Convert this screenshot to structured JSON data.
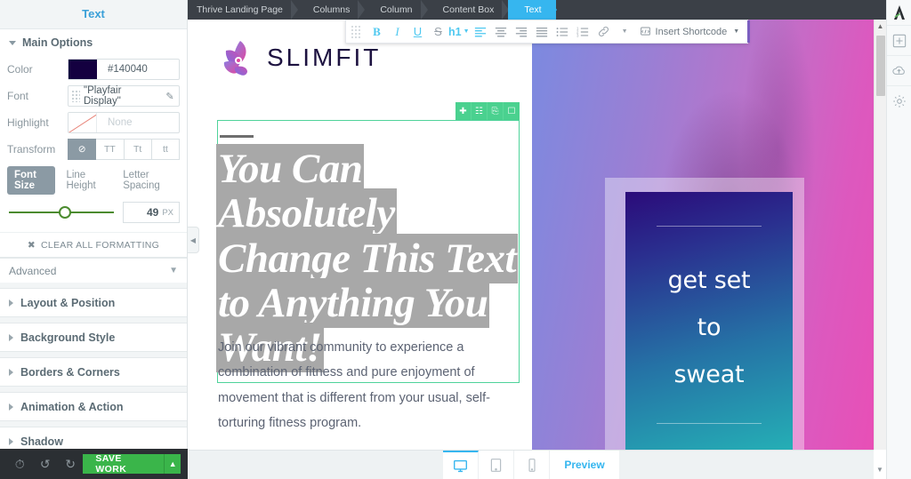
{
  "sidebar": {
    "title": "Text",
    "main_options": {
      "label": "Main Options",
      "color": {
        "label": "Color",
        "value": "#140040",
        "swatch": "#140040"
      },
      "font": {
        "label": "Font",
        "value": "\"Playfair Display\"",
        "edit_icon": "pencil-icon"
      },
      "highlight": {
        "label": "Highlight",
        "value": "None"
      },
      "transform": {
        "label": "Transform",
        "options": [
          "⊘",
          "TT",
          "Tt",
          "tt"
        ],
        "active_index": 0
      },
      "size_tabs": [
        "Font Size",
        "Line Height",
        "Letter Spacing"
      ],
      "size_tab_active": "Font Size",
      "slider_value": "49",
      "slider_unit": "PX",
      "clear_formatting": "CLEAR ALL FORMATTING",
      "advanced": "Advanced"
    },
    "accordions": [
      "Layout & Position",
      "Background Style",
      "Borders & Corners",
      "Animation & Action",
      "Shadow"
    ],
    "footer": {
      "history_icon": "clock-icon",
      "undo_icon": "undo-icon",
      "redo_icon": "redo-icon",
      "save_label": "SAVE WORK",
      "save_color": "#3ab54a"
    },
    "collapse_icon": "chevron-left-icon"
  },
  "breadcrumb": {
    "items": [
      {
        "label": "Thrive Landing Page",
        "active": false
      },
      {
        "label": "Columns",
        "active": false
      },
      {
        "label": "Column",
        "active": false
      },
      {
        "label": "Content Box",
        "active": false
      },
      {
        "label": "Text",
        "active": true
      }
    ],
    "active_color": "#36b6ef"
  },
  "format_toolbar": {
    "grip": "drag-grip-icon",
    "buttons": [
      {
        "name": "bold",
        "label": "B",
        "active": true
      },
      {
        "name": "italic",
        "label": "I",
        "active": true
      },
      {
        "name": "underline",
        "label": "U",
        "active": true
      },
      {
        "name": "strikethrough",
        "label": "S",
        "active": false
      },
      {
        "name": "heading",
        "label": "h1",
        "active": true,
        "dropdown": true
      }
    ],
    "align": [
      {
        "name": "align-left",
        "active": true
      },
      {
        "name": "align-center",
        "active": false
      },
      {
        "name": "align-right",
        "active": false
      },
      {
        "name": "align-justify",
        "active": false
      }
    ],
    "lists": [
      {
        "name": "bullet-list"
      },
      {
        "name": "numbered-list"
      }
    ],
    "link": {
      "name": "link-icon",
      "dropdown": true
    },
    "shortcode": {
      "icon": "shortcode-icon",
      "label": "Insert Shortcode",
      "dropdown": true
    }
  },
  "canvas": {
    "logo": {
      "icon": "slimfit-butterfly-logo",
      "text": "SLIMFIT"
    },
    "selected_block": {
      "toolbar_icons": [
        "move-icon",
        "clone-icon",
        "save-template-icon",
        "delete-icon"
      ],
      "toolbar_color": "#4ad18f",
      "border_color": "#4fd39a",
      "headline": "You Can Absolutely Change This Text to Anything You Want!",
      "selection_color": "#a8a8a8"
    },
    "paragraph": "Join our vibrant community to experience a combination of fitness and pure enjoyment of movement that is different from your usual, self-torturing fitness program.",
    "hero_card": {
      "lines": [
        "get set",
        "to",
        "sweat"
      ]
    },
    "scrollbar": {
      "up_icon": "chevron-up-icon",
      "down_icon": "chevron-down-icon"
    }
  },
  "device_bar": {
    "devices": [
      {
        "name": "desktop",
        "active": true
      },
      {
        "name": "tablet",
        "active": false
      },
      {
        "name": "mobile",
        "active": false
      }
    ],
    "preview_label": "Preview",
    "accent": "#36b6ef"
  },
  "right_rail": {
    "logo_icon": "thrive-architect-logo",
    "items": [
      "add-element-icon",
      "cloud-templates-icon",
      "settings-gear-icon"
    ]
  }
}
